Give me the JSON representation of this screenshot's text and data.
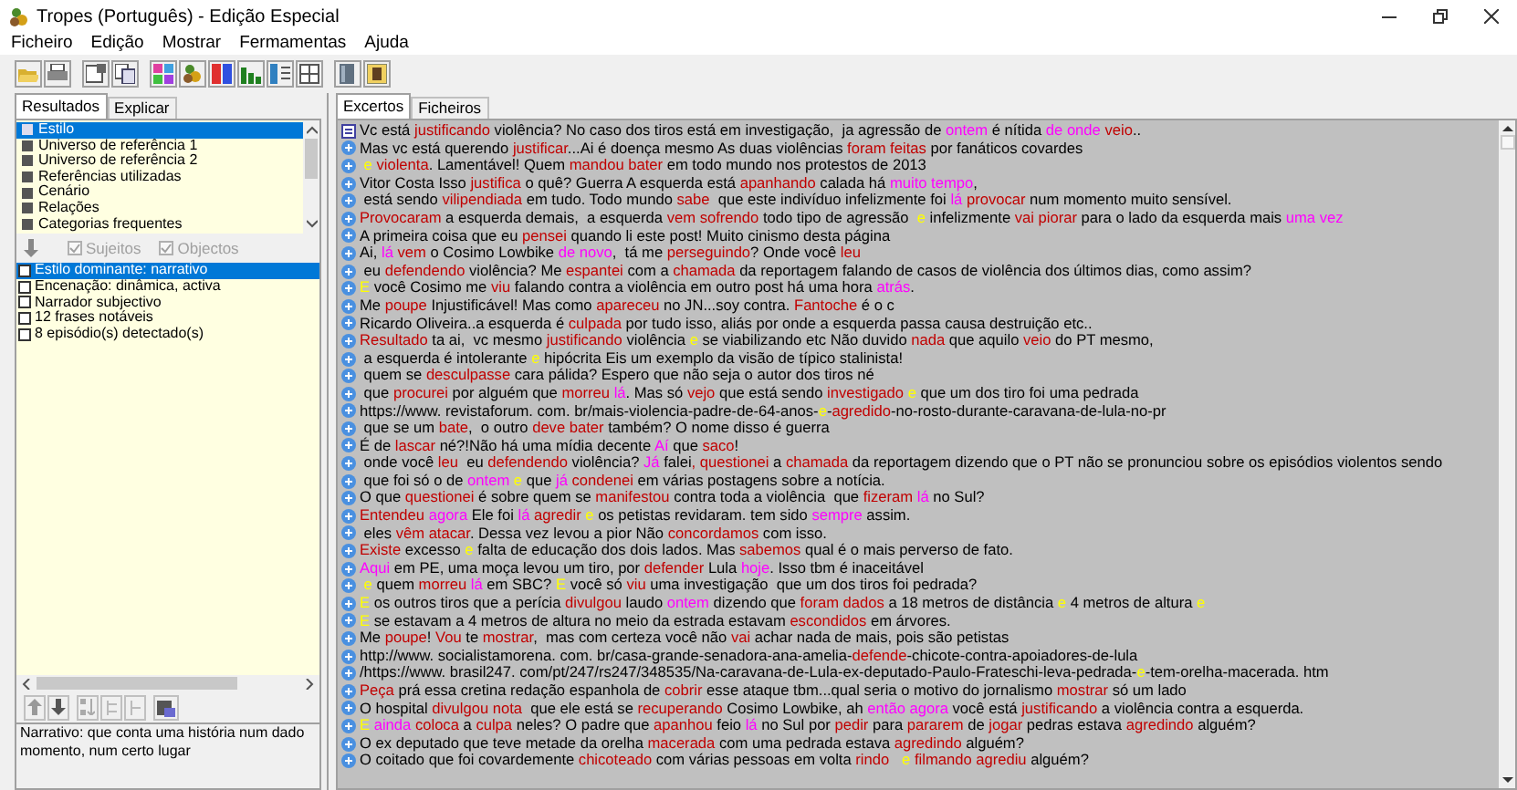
{
  "window": {
    "title": "Tropes (Português) - Edição Especial"
  },
  "menu": [
    "Ficheiro",
    "Edição",
    "Mostrar",
    "Fermamentas",
    "Ajuda"
  ],
  "left_tabs": [
    {
      "label": "Resultados",
      "selected": true
    },
    {
      "label": "Explicar",
      "selected": false
    }
  ],
  "categories": [
    {
      "label": "Estilo",
      "selected": true
    },
    {
      "label": "Universo de referência 1",
      "selected": false
    },
    {
      "label": "Universo de referência 2",
      "selected": false
    },
    {
      "label": "Referências utilizadas",
      "selected": false
    },
    {
      "label": "Cenário",
      "selected": false
    },
    {
      "label": "Relações",
      "selected": false
    },
    {
      "label": "Categorias frequentes",
      "selected": false
    }
  ],
  "filters": [
    {
      "label": "Sujeitos",
      "checked": true,
      "disabled": true
    },
    {
      "label": "Objectos",
      "checked": true,
      "disabled": true
    }
  ],
  "results": [
    {
      "label": "Estilo dominante: narrativo",
      "selected": true,
      "checked": false
    },
    {
      "label": "Encenação: dinâmica, activa",
      "selected": false,
      "checked": false
    },
    {
      "label": "Narrador subjectivo",
      "selected": false,
      "checked": false
    },
    {
      "label": "12 frases notáveis",
      "selected": false,
      "checked": false
    },
    {
      "label": "8 episódio(s) detectado(s)",
      "selected": false,
      "checked": false
    }
  ],
  "explanation": "Narrativo: que conta uma história num dado momento, num certo lugar",
  "right_tabs": [
    {
      "label": "Excertos",
      "selected": true
    },
    {
      "label": "Ficheiros",
      "selected": false
    }
  ],
  "excerpts": [
    {
      "kind": "document",
      "parts": [
        {
          "text": "Vc está "
        },
        {
          "text": "justificando",
          "color": "#c00000"
        },
        {
          "text": " violência? No caso dos tiros está em investigação,  ja agressão de "
        },
        {
          "text": "ontem",
          "color": "#ff00ff"
        },
        {
          "text": " é nítida "
        },
        {
          "text": "de onde",
          "color": "#ff00ff"
        },
        {
          "text": " veio",
          "color": "#c00000"
        },
        {
          "text": ".."
        }
      ]
    },
    {
      "kind": "excerpt",
      "parts": [
        {
          "text": "Mas vc está querendo "
        },
        {
          "text": "justificar",
          "color": "#c00000"
        },
        {
          "text": "...Ai é doença mesmo As duas violências "
        },
        {
          "text": "foram feitas",
          "color": "#c00000"
        },
        {
          "text": " por fanáticos covardes"
        }
      ]
    },
    {
      "kind": "excerpt",
      "parts": [
        {
          "text": " e",
          "color": "#ffff00"
        },
        {
          "text": " violenta",
          "color": "#c00000"
        },
        {
          "text": ". Lamentável! Quem "
        },
        {
          "text": "mandou bater",
          "color": "#c00000"
        },
        {
          "text": " em todo mundo nos protestos de 2013"
        }
      ]
    },
    {
      "kind": "excerpt",
      "parts": [
        {
          "text": "Vitor Costa Isso "
        },
        {
          "text": "justifica",
          "color": "#c00000"
        },
        {
          "text": " o quê? Guerra A esquerda está "
        },
        {
          "text": "apanhando",
          "color": "#c00000"
        },
        {
          "text": " calada há "
        },
        {
          "text": "muito tempo",
          "color": "#ff00ff"
        },
        {
          "text": ","
        }
      ]
    },
    {
      "kind": "excerpt",
      "parts": [
        {
          "text": " está sendo "
        },
        {
          "text": "vilipendiada",
          "color": "#c00000"
        },
        {
          "text": " em tudo. Todo mundo "
        },
        {
          "text": "sabe",
          "color": "#c00000"
        },
        {
          "text": "  que este indivíduo infelizmente foi "
        },
        {
          "text": "lá",
          "color": "#ff00ff"
        },
        {
          "text": " provocar",
          "color": "#c00000"
        },
        {
          "text": " num momento muito sensível."
        }
      ]
    },
    {
      "kind": "excerpt",
      "parts": [
        {
          "text": "Provocaram",
          "color": "#c00000"
        },
        {
          "text": " a esquerda demais,  a esquerda "
        },
        {
          "text": "vem sofrendo",
          "color": "#c00000"
        },
        {
          "text": " todo tipo de agressão  "
        },
        {
          "text": "e",
          "color": "#ffff00"
        },
        {
          "text": " infelizmente "
        },
        {
          "text": "vai piorar",
          "color": "#c00000"
        },
        {
          "text": " para o lado da esquerda mais "
        },
        {
          "text": "uma vez",
          "color": "#ff00ff"
        }
      ]
    },
    {
      "kind": "excerpt",
      "parts": [
        {
          "text": "A primeira coisa que eu "
        },
        {
          "text": "pensei",
          "color": "#c00000"
        },
        {
          "text": " quando li este post! Muito cinismo desta página"
        }
      ]
    },
    {
      "kind": "excerpt",
      "parts": [
        {
          "text": "Ai, "
        },
        {
          "text": "lá",
          "color": "#ff00ff"
        },
        {
          "text": " vem",
          "color": "#c00000"
        },
        {
          "text": " o Cosimo Lowbike "
        },
        {
          "text": "de novo",
          "color": "#ff00ff"
        },
        {
          "text": ",  tá me "
        },
        {
          "text": "perseguindo",
          "color": "#c00000"
        },
        {
          "text": "? Onde você "
        },
        {
          "text": "leu",
          "color": "#c00000"
        }
      ]
    },
    {
      "kind": "excerpt",
      "parts": [
        {
          "text": " eu "
        },
        {
          "text": "defendendo",
          "color": "#c00000"
        },
        {
          "text": " violência? Me "
        },
        {
          "text": "espantei",
          "color": "#c00000"
        },
        {
          "text": " com a "
        },
        {
          "text": "chamada",
          "color": "#c00000"
        },
        {
          "text": " da reportagem falando de casos de violência dos últimos dias, como assim?"
        }
      ]
    },
    {
      "kind": "excerpt",
      "parts": [
        {
          "text": "E",
          "color": "#ffff00"
        },
        {
          "text": " você Cosimo me "
        },
        {
          "text": "viu",
          "color": "#c00000"
        },
        {
          "text": " falando contra a violência em outro post há uma hora "
        },
        {
          "text": "atrás",
          "color": "#ff00ff"
        },
        {
          "text": "."
        }
      ]
    },
    {
      "kind": "excerpt",
      "parts": [
        {
          "text": "Me "
        },
        {
          "text": "poupe",
          "color": "#c00000"
        },
        {
          "text": " Injustificável! Mas como "
        },
        {
          "text": "apareceu",
          "color": "#c00000"
        },
        {
          "text": " no JN...soy contra. "
        },
        {
          "text": "Fantoche",
          "color": "#c00000"
        },
        {
          "text": " é o c"
        }
      ]
    },
    {
      "kind": "excerpt",
      "parts": [
        {
          "text": "Ricardo Oliveira..a esquerda é "
        },
        {
          "text": "culpada",
          "color": "#c00000"
        },
        {
          "text": " por tudo isso, aliás por onde a esquerda passa causa destruição etc.."
        }
      ]
    },
    {
      "kind": "excerpt",
      "parts": [
        {
          "text": "Resultado",
          "color": "#c00000"
        },
        {
          "text": " ta ai,  vc mesmo "
        },
        {
          "text": "justificando",
          "color": "#c00000"
        },
        {
          "text": " violência "
        },
        {
          "text": "e",
          "color": "#ffff00"
        },
        {
          "text": " se viabilizando etc Não duvido "
        },
        {
          "text": "nada",
          "color": "#c00000"
        },
        {
          "text": " que aquilo "
        },
        {
          "text": "veio",
          "color": "#c00000"
        },
        {
          "text": " do PT mesmo,"
        }
      ]
    },
    {
      "kind": "excerpt",
      "parts": [
        {
          "text": " a esquerda é intolerante "
        },
        {
          "text": "e",
          "color": "#ffff00"
        },
        {
          "text": " hipócrita Eis um exemplo da visão de típico stalinista!"
        }
      ]
    },
    {
      "kind": "excerpt",
      "parts": [
        {
          "text": " quem se "
        },
        {
          "text": "desculpasse",
          "color": "#c00000"
        },
        {
          "text": " cara pálida? Espero que não seja o autor dos tiros né"
        }
      ]
    },
    {
      "kind": "excerpt",
      "parts": [
        {
          "text": " que "
        },
        {
          "text": "procurei",
          "color": "#c00000"
        },
        {
          "text": " por alguém que "
        },
        {
          "text": "morreu",
          "color": "#c00000"
        },
        {
          "text": " lá",
          "color": "#ff00ff"
        },
        {
          "text": ". Mas só "
        },
        {
          "text": "vejo",
          "color": "#c00000"
        },
        {
          "text": " que está sendo "
        },
        {
          "text": "investigado",
          "color": "#c00000"
        },
        {
          "text": " e",
          "color": "#ffff00"
        },
        {
          "text": " que um dos tiro foi uma pedrada"
        }
      ]
    },
    {
      "kind": "excerpt",
      "parts": [
        {
          "text": "https://www. revistaforum. com. br/mais-violencia-padre-de-64-anos-"
        },
        {
          "text": "e",
          "color": "#ffff00"
        },
        {
          "text": "-"
        },
        {
          "text": "agredido",
          "color": "#c00000"
        },
        {
          "text": "-no-rosto-durante-caravana-de-lula-no-pr"
        }
      ]
    },
    {
      "kind": "excerpt",
      "parts": [
        {
          "text": " que se um "
        },
        {
          "text": "bate",
          "color": "#c00000"
        },
        {
          "text": ",  o outro "
        },
        {
          "text": "deve bater",
          "color": "#c00000"
        },
        {
          "text": " também? O nome disso é guerra"
        }
      ]
    },
    {
      "kind": "excerpt",
      "parts": [
        {
          "text": "É de "
        },
        {
          "text": "lascar",
          "color": "#c00000"
        },
        {
          "text": " né?!Não há uma mídia decente "
        },
        {
          "text": "Aí",
          "color": "#ff00ff"
        },
        {
          "text": " que "
        },
        {
          "text": "saco",
          "color": "#c00000"
        },
        {
          "text": "!"
        }
      ]
    },
    {
      "kind": "excerpt",
      "parts": [
        {
          "text": " onde você "
        },
        {
          "text": "leu",
          "color": "#c00000"
        },
        {
          "text": "  eu "
        },
        {
          "text": "defendendo",
          "color": "#c00000"
        },
        {
          "text": " violência? "
        },
        {
          "text": "Já",
          "color": "#ff00ff"
        },
        {
          "text": " falei"
        },
        {
          "text": ", questionei",
          "color": "#c00000"
        },
        {
          "text": " a "
        },
        {
          "text": "chamada",
          "color": "#c00000"
        },
        {
          "text": " da reportagem dizendo que o PT não se pronunciou sobre os episódios violentos sendo"
        }
      ]
    },
    {
      "kind": "excerpt",
      "parts": [
        {
          "text": " que foi só o de "
        },
        {
          "text": "ontem",
          "color": "#ff00ff"
        },
        {
          "text": " e",
          "color": "#ffff00"
        },
        {
          "text": " que "
        },
        {
          "text": "já",
          "color": "#ff00ff"
        },
        {
          "text": " condenei",
          "color": "#c00000"
        },
        {
          "text": " em várias postagens sobre a notícia."
        }
      ]
    },
    {
      "kind": "excerpt",
      "parts": [
        {
          "text": "O que "
        },
        {
          "text": "questionei",
          "color": "#c00000"
        },
        {
          "text": " é sobre quem se "
        },
        {
          "text": "manifestou",
          "color": "#c00000"
        },
        {
          "text": " contra toda a violência  que "
        },
        {
          "text": "fizeram",
          "color": "#c00000"
        },
        {
          "text": " lá",
          "color": "#ff00ff"
        },
        {
          "text": " no Sul?"
        }
      ]
    },
    {
      "kind": "excerpt",
      "parts": [
        {
          "text": "Entendeu",
          "color": "#c00000"
        },
        {
          "text": " agora",
          "color": "#ff00ff"
        },
        {
          "text": " Ele foi "
        },
        {
          "text": "lá",
          "color": "#ff00ff"
        },
        {
          "text": " agredir",
          "color": "#c00000"
        },
        {
          "text": " e",
          "color": "#ffff00"
        },
        {
          "text": " os petistas revidaram. tem sido "
        },
        {
          "text": "sempre",
          "color": "#ff00ff"
        },
        {
          "text": " assim."
        }
      ]
    },
    {
      "kind": "excerpt",
      "parts": [
        {
          "text": " eles "
        },
        {
          "text": "vêm atacar",
          "color": "#c00000"
        },
        {
          "text": ". Dessa vez levou a pior Não "
        },
        {
          "text": "concordamos",
          "color": "#c00000"
        },
        {
          "text": " com isso."
        }
      ]
    },
    {
      "kind": "excerpt",
      "parts": [
        {
          "text": "Existe",
          "color": "#c00000"
        },
        {
          "text": " excesso "
        },
        {
          "text": "e",
          "color": "#ffff00"
        },
        {
          "text": " falta de educação dos dois lados. Mas "
        },
        {
          "text": "sabemos",
          "color": "#c00000"
        },
        {
          "text": " qual é o mais perverso de fato."
        }
      ]
    },
    {
      "kind": "excerpt",
      "parts": [
        {
          "text": "Aqui",
          "color": "#ff00ff"
        },
        {
          "text": " em PE, uma moça levou um tiro, por "
        },
        {
          "text": "defender",
          "color": "#c00000"
        },
        {
          "text": " Lula "
        },
        {
          "text": "hoje",
          "color": "#ff00ff"
        },
        {
          "text": ". Isso tbm é inaceitável"
        }
      ]
    },
    {
      "kind": "excerpt",
      "parts": [
        {
          "text": " e",
          "color": "#ffff00"
        },
        {
          "text": " quem "
        },
        {
          "text": "morreu",
          "color": "#c00000"
        },
        {
          "text": " lá",
          "color": "#ff00ff"
        },
        {
          "text": " em SBC? "
        },
        {
          "text": "E",
          "color": "#ffff00"
        },
        {
          "text": " você só "
        },
        {
          "text": "viu",
          "color": "#c00000"
        },
        {
          "text": " uma investigação  que um dos tiros foi pedrada?"
        }
      ]
    },
    {
      "kind": "excerpt",
      "parts": [
        {
          "text": "E",
          "color": "#ffff00"
        },
        {
          "text": " os outros tiros que a perícia "
        },
        {
          "text": "divulgou",
          "color": "#c00000"
        },
        {
          "text": " laudo "
        },
        {
          "text": "ontem",
          "color": "#ff00ff"
        },
        {
          "text": " dizendo que "
        },
        {
          "text": "foram dados",
          "color": "#c00000"
        },
        {
          "text": " a 18 metros de distância "
        },
        {
          "text": "e",
          "color": "#ffff00"
        },
        {
          "text": " 4 metros de altura "
        },
        {
          "text": "e",
          "color": "#ffff00"
        }
      ]
    },
    {
      "kind": "excerpt",
      "parts": [
        {
          "text": "E",
          "color": "#ffff00"
        },
        {
          "text": " se estavam a 4 metros de altura no meio da estrada estavam "
        },
        {
          "text": "escondidos",
          "color": "#c00000"
        },
        {
          "text": " em árvores."
        }
      ]
    },
    {
      "kind": "excerpt",
      "parts": [
        {
          "text": "Me "
        },
        {
          "text": "poupe",
          "color": "#c00000"
        },
        {
          "text": "! "
        },
        {
          "text": "Vou",
          "color": "#c00000"
        },
        {
          "text": " te "
        },
        {
          "text": "mostrar",
          "color": "#c00000"
        },
        {
          "text": ",  mas com certeza você não "
        },
        {
          "text": "vai",
          "color": "#c00000"
        },
        {
          "text": " achar nada de mais, pois são petistas"
        }
      ]
    },
    {
      "kind": "excerpt",
      "parts": [
        {
          "text": "http://www. socialistamorena. com. br/casa-grande-senadora-ana-amelia-"
        },
        {
          "text": "defende",
          "color": "#c00000"
        },
        {
          "text": "-chicote-contra-apoiadores-de-lula"
        }
      ]
    },
    {
      "kind": "excerpt",
      "parts": [
        {
          "text": "/https://www. brasil247. com/pt/247/rs247/348535/Na-caravana-de-Lula-ex-deputado-Paulo-Frateschi-leva-pedrada-"
        },
        {
          "text": "e",
          "color": "#ffff00"
        },
        {
          "text": "-tem-orelha-macerada. htm"
        }
      ]
    },
    {
      "kind": "excerpt",
      "parts": [
        {
          "text": "Peça",
          "color": "#c00000"
        },
        {
          "text": " prá essa cretina redação espanhola de "
        },
        {
          "text": "cobrir",
          "color": "#c00000"
        },
        {
          "text": " esse ataque tbm...qual seria o motivo do jornalismo "
        },
        {
          "text": "mostrar",
          "color": "#c00000"
        },
        {
          "text": " só um lado"
        }
      ]
    },
    {
      "kind": "excerpt",
      "parts": [
        {
          "text": "O hospital "
        },
        {
          "text": "divulgou nota",
          "color": "#c00000"
        },
        {
          "text": "  que ele está se "
        },
        {
          "text": "recuperando",
          "color": "#c00000"
        },
        {
          "text": " Cosimo Lowbike, ah "
        },
        {
          "text": "então agora",
          "color": "#ff00ff"
        },
        {
          "text": " você está "
        },
        {
          "text": "justificando",
          "color": "#c00000"
        },
        {
          "text": " a violência contra a esquerda."
        }
      ]
    },
    {
      "kind": "excerpt",
      "parts": [
        {
          "text": "E",
          "color": "#ffff00"
        },
        {
          "text": " ainda",
          "color": "#ff00ff"
        },
        {
          "text": " coloca",
          "color": "#c00000"
        },
        {
          "text": " a "
        },
        {
          "text": "culpa",
          "color": "#c00000"
        },
        {
          "text": " neles? O padre que "
        },
        {
          "text": "apanhou",
          "color": "#c00000"
        },
        {
          "text": " feio "
        },
        {
          "text": "lá",
          "color": "#ff00ff"
        },
        {
          "text": " no Sul por "
        },
        {
          "text": "pedir",
          "color": "#c00000"
        },
        {
          "text": " para "
        },
        {
          "text": "pararem",
          "color": "#c00000"
        },
        {
          "text": " de "
        },
        {
          "text": "jogar",
          "color": "#c00000"
        },
        {
          "text": " pedras estava "
        },
        {
          "text": "agredindo",
          "color": "#c00000"
        },
        {
          "text": " alguém?"
        }
      ]
    },
    {
      "kind": "excerpt",
      "parts": [
        {
          "text": "O ex deputado que teve metade da orelha "
        },
        {
          "text": "macerada",
          "color": "#c00000"
        },
        {
          "text": " com uma pedrada estava "
        },
        {
          "text": "agredindo",
          "color": "#c00000"
        },
        {
          "text": " alguém?"
        }
      ]
    },
    {
      "kind": "excerpt",
      "parts": [
        {
          "text": "O coitado que foi covardemente "
        },
        {
          "text": "chicoteado",
          "color": "#c00000"
        },
        {
          "text": " com várias pessoas em volta "
        },
        {
          "text": "rindo",
          "color": "#c00000"
        },
        {
          "text": "   e",
          "color": "#ffff00"
        },
        {
          "text": " filmando",
          "color": "#c00000"
        },
        {
          "text": " agrediu",
          "color": "#c00000"
        },
        {
          "text": " alguém?"
        }
      ]
    }
  ]
}
